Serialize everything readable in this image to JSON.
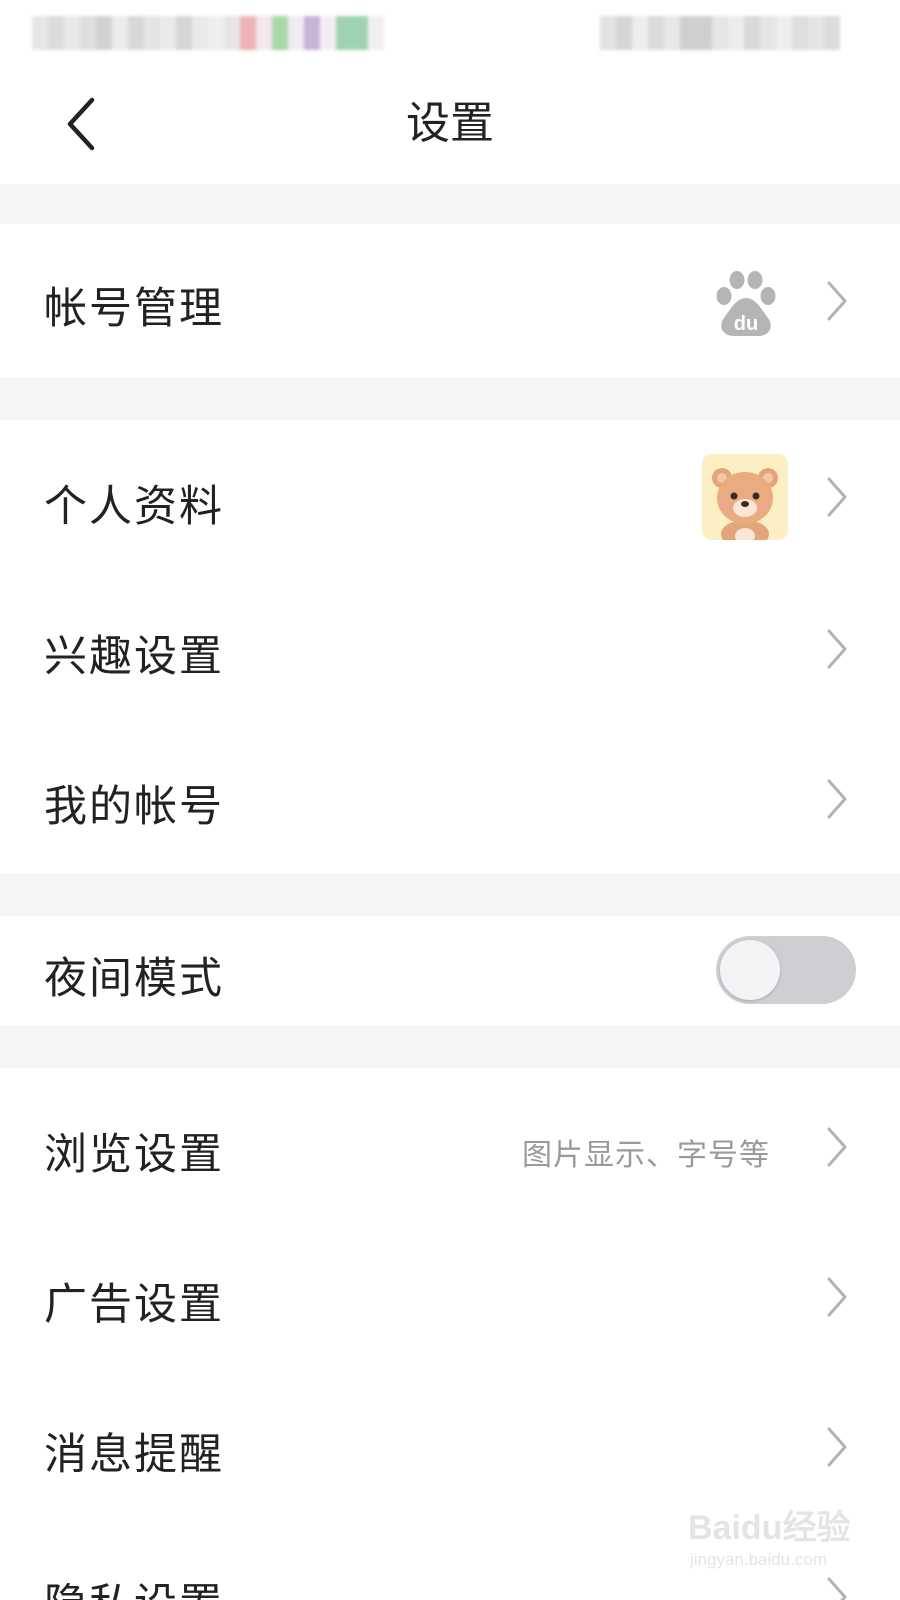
{
  "header": {
    "title": "设置",
    "back_icon": "chevron-left-icon"
  },
  "sections": {
    "account_management": {
      "label": "帐号管理",
      "icon": "baidu-paw-icon"
    },
    "profile": {
      "label": "个人资料",
      "avatar": "bear-avatar"
    },
    "interest": {
      "label": "兴趣设置"
    },
    "my_account": {
      "label": "我的帐号"
    },
    "night_mode": {
      "label": "夜间模式",
      "enabled": false
    },
    "browse": {
      "label": "浏览设置",
      "hint": "图片显示、字号等"
    },
    "ads": {
      "label": "广告设置"
    },
    "notifications": {
      "label": "消息提醒"
    },
    "privacy": {
      "label": "隐私设置"
    }
  },
  "watermark": {
    "line1": "Baidu经验",
    "line2": "jingyan.baidu.com"
  },
  "colors": {
    "background": "#ffffff",
    "section_gap": "#f4f5f7",
    "text_primary": "#222222",
    "text_secondary": "#9a9a9a",
    "chevron": "#b3b3b3",
    "toggle_off": "#cfcfd3"
  }
}
